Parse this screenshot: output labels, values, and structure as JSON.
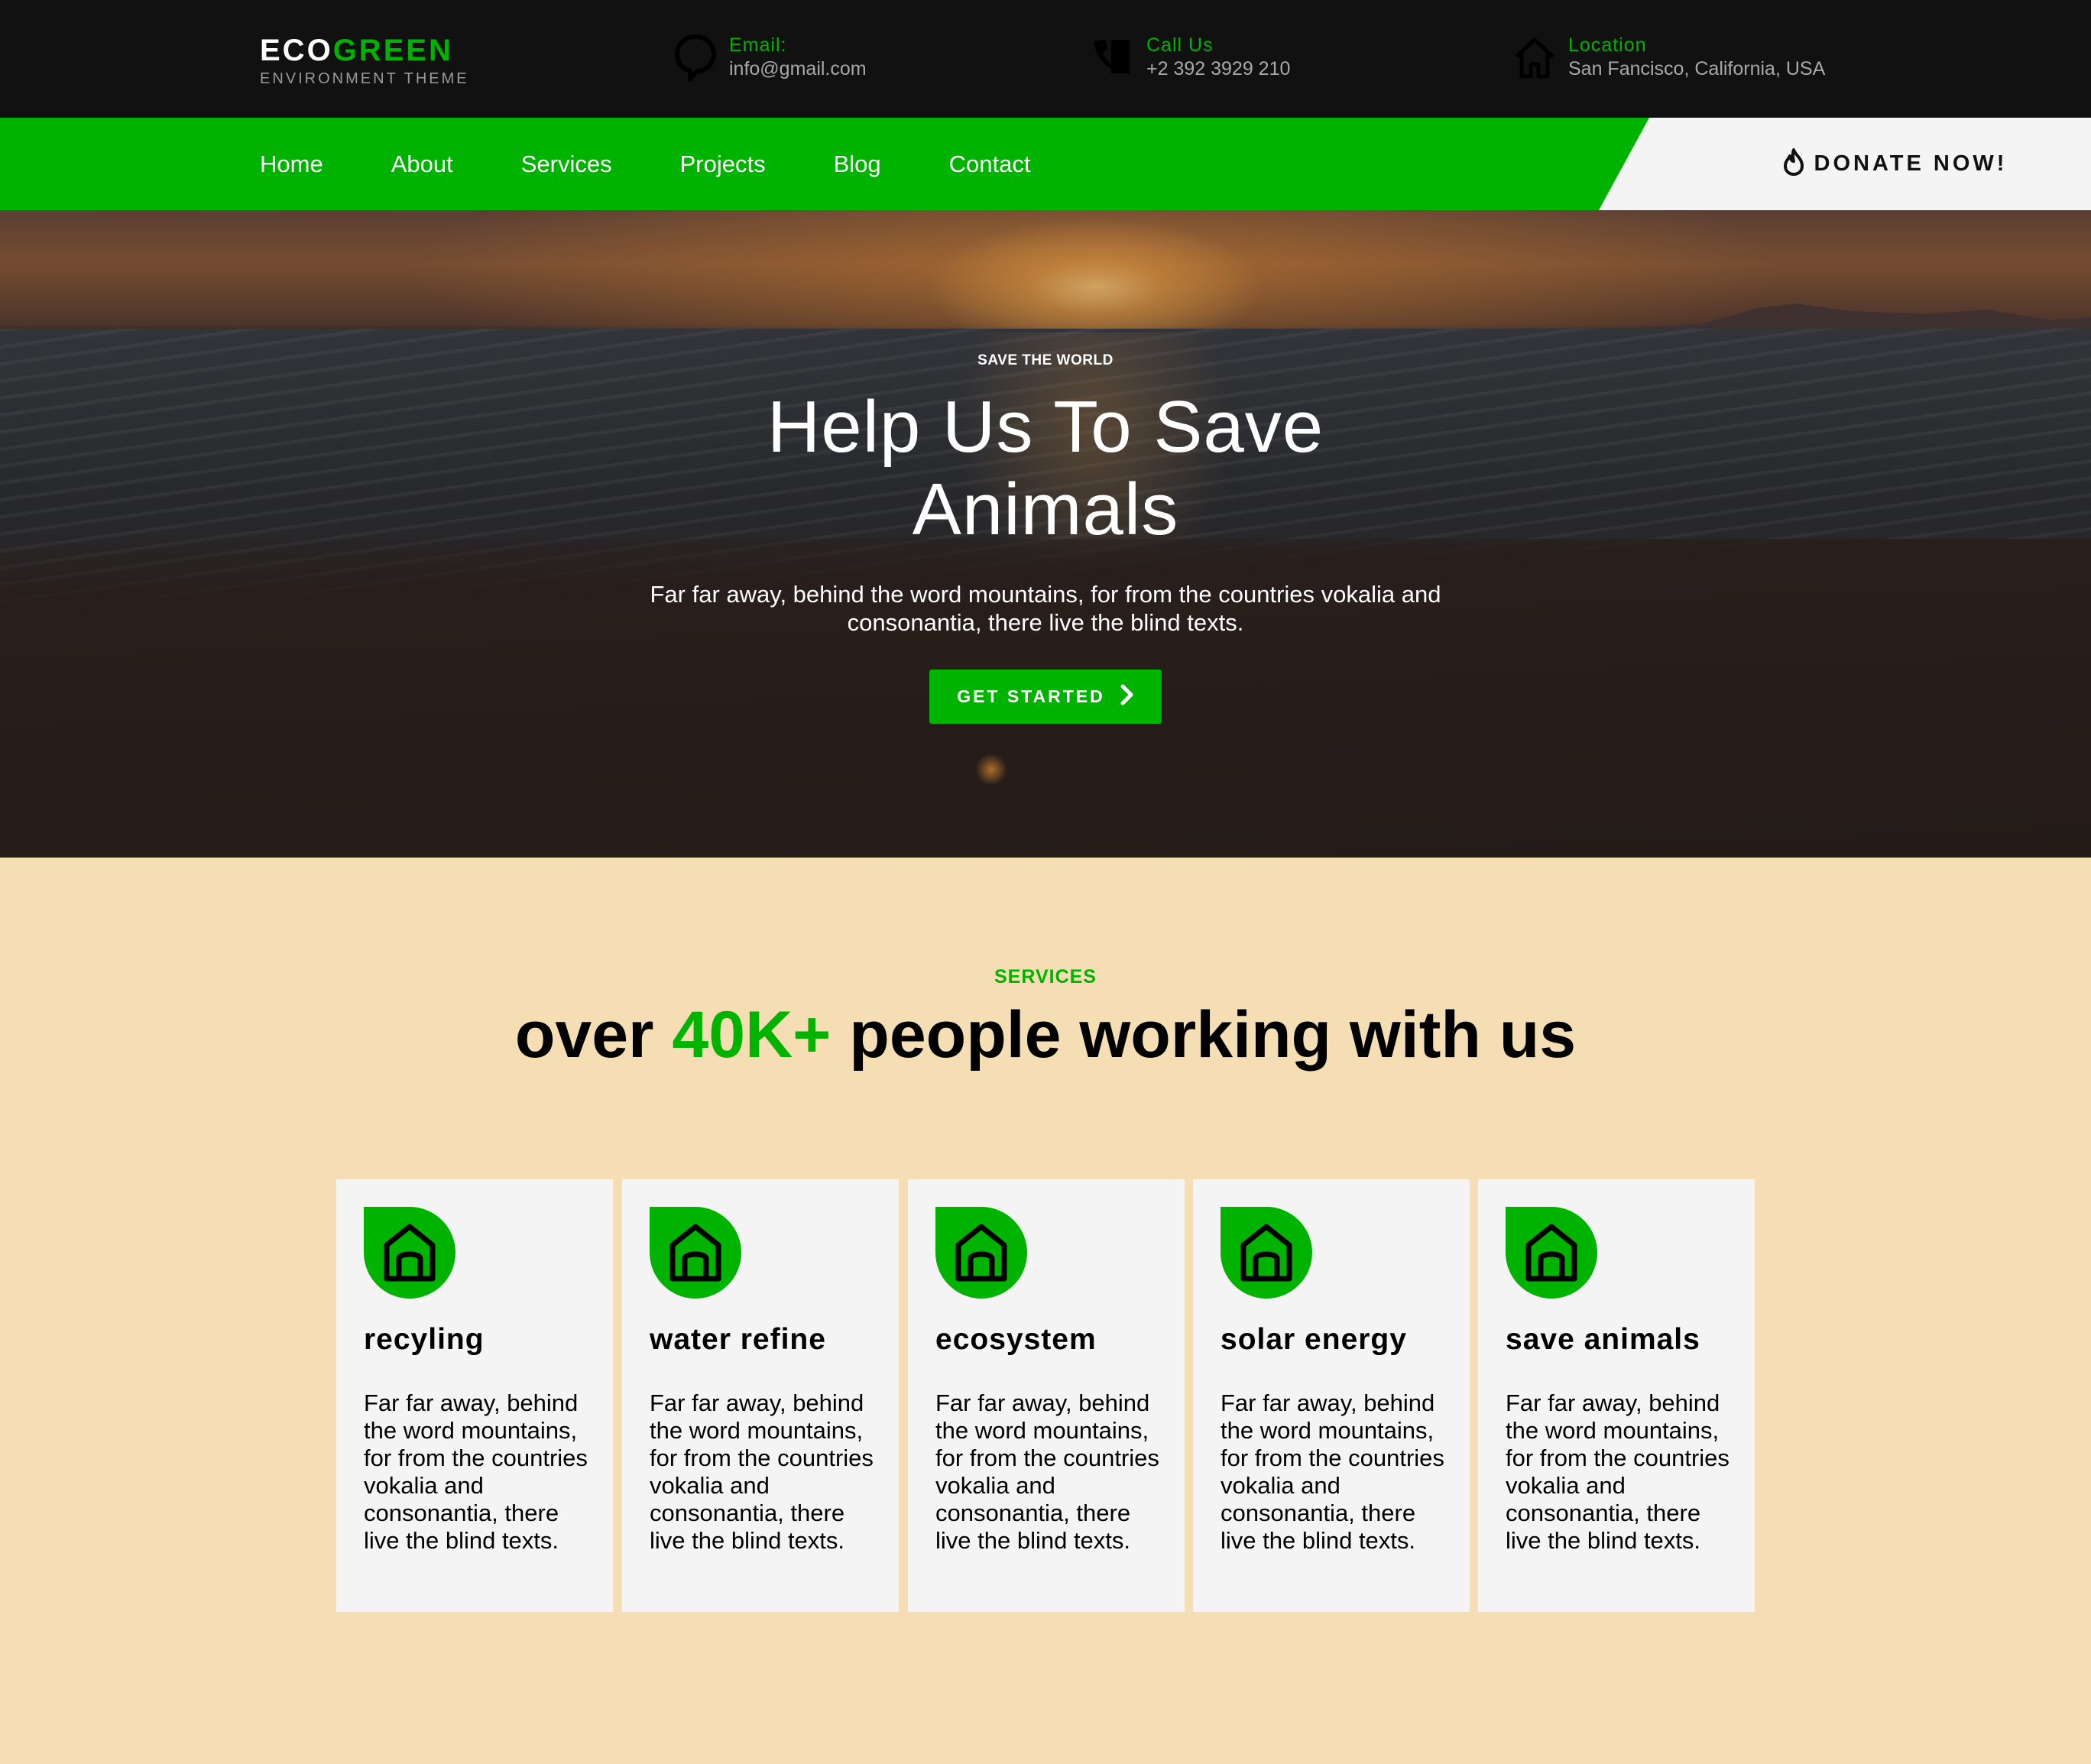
{
  "brand": {
    "first": "ECO",
    "second": "GREEN",
    "tagline": "ENVIRONMENT THEME"
  },
  "contacts": [
    {
      "icon": "chat-bubble-icon",
      "label": "Email:",
      "value": "info@gmail.com"
    },
    {
      "icon": "phone-icon",
      "label": "Call Us",
      "value": "+2 392 3929 210"
    },
    {
      "icon": "home-icon",
      "label": "Location",
      "value": "San Fancisco, California, USA"
    }
  ],
  "nav": {
    "items": [
      "Home",
      "About",
      "Services",
      "Projects",
      "Blog",
      "Contact"
    ]
  },
  "donate": {
    "label": "DONATE NOW!",
    "icon": "flame-icon"
  },
  "hero": {
    "kicker": "SAVE THE WORLD",
    "title": "Help Us To Save Animals",
    "text": "Far far away, behind the word mountains, for from the countries vokalia and consonantia, there live the blind texts.",
    "button": "GET STARTED",
    "button_icon": "chevron-right-icon"
  },
  "services": {
    "kicker": "SERVICES",
    "title_before": "over ",
    "title_highlight": "40K+",
    "title_after": " people working with us",
    "cards": [
      {
        "icon": "house-icon",
        "title": "recyling",
        "text": "Far far away, behind the word mountains, for from the countries vokalia and consonantia, there live the blind texts."
      },
      {
        "icon": "house-icon",
        "title": "water refine",
        "text": "Far far away, behind the word mountains, for from the countries vokalia and consonantia, there live the blind texts."
      },
      {
        "icon": "house-icon",
        "title": "ecosystem",
        "text": "Far far away, behind the word mountains, for from the countries vokalia and consonantia, there live the blind texts."
      },
      {
        "icon": "house-icon",
        "title": "solar energy",
        "text": "Far far away, behind the word mountains, for from the countries vokalia and consonantia, there live the blind texts."
      },
      {
        "icon": "house-icon",
        "title": "save animals",
        "text": "Far far away, behind the word mountains, for from the countries vokalia and consonantia, there live the blind texts."
      }
    ]
  },
  "colors": {
    "accent": "#00b300",
    "topbar": "#111111",
    "section_bg": "#f5deb3",
    "card_bg": "#f4f4f4"
  }
}
